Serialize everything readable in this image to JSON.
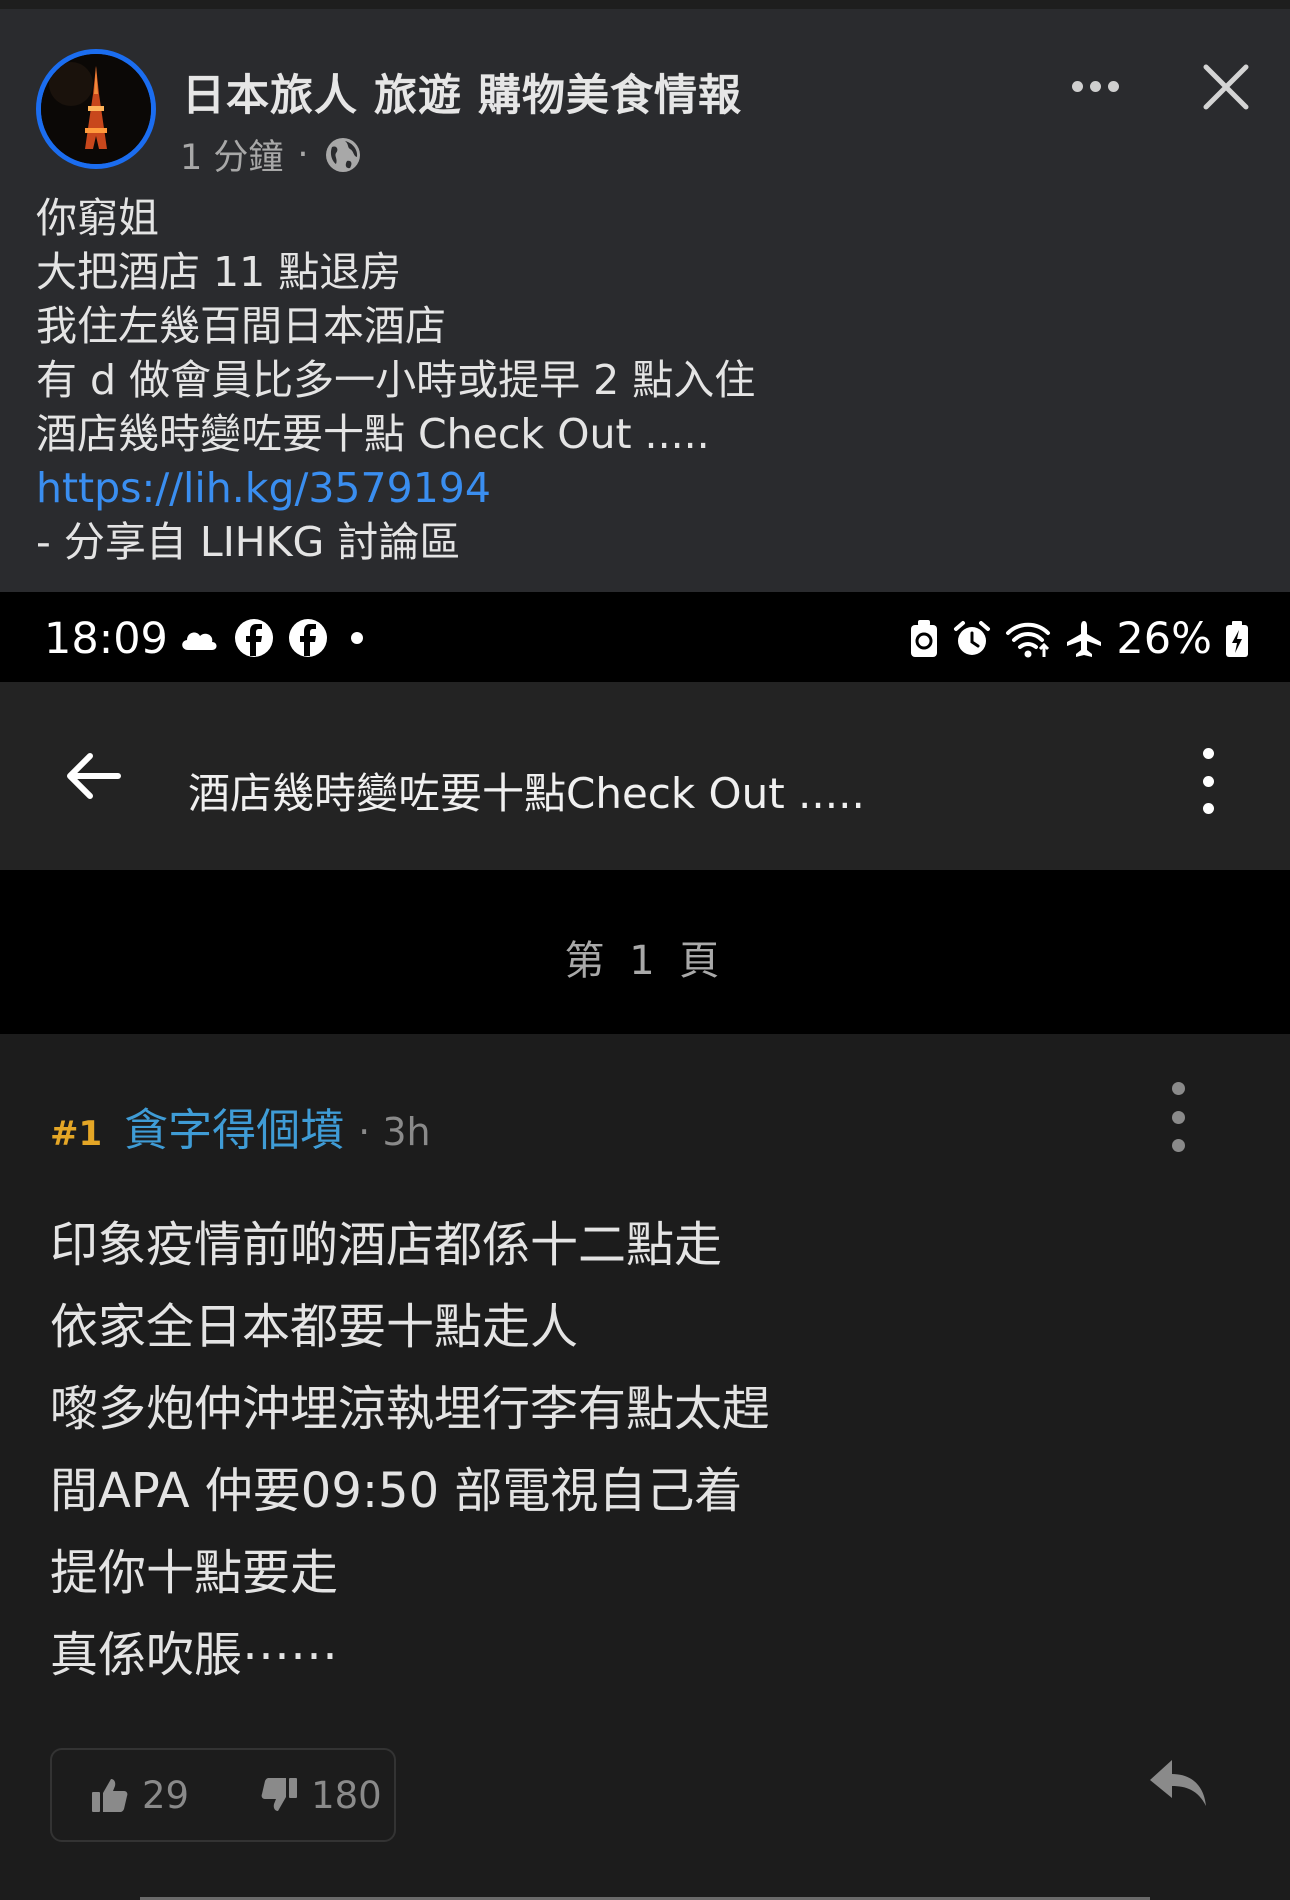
{
  "post": {
    "page_name": "日本旅人  旅遊 購物美食情報",
    "time": "1 分鐘",
    "separator": "·",
    "lines": [
      "你窮姐",
      "大把酒店 11 點退房",
      "我住左幾百間日本酒店",
      "有 d 做會員比多一小時或提早 2 點入住",
      "酒店幾時變咗要十點 Check Out ....."
    ],
    "link": "https://lih.kg/3579194",
    "source": "- 分享自 LIHKG 討論區"
  },
  "status_bar": {
    "time": "18:09",
    "battery": "26%",
    "left_icons": [
      "cloud-icon",
      "facebook-icon",
      "facebook-icon",
      "dot-icon"
    ],
    "right_icons": [
      "battery-saver-icon",
      "alarm-icon",
      "wifi-icon",
      "airplane-icon",
      "battery-charging-icon"
    ]
  },
  "thread": {
    "title": "酒店幾時變咗要十點Check Out .....",
    "page_label": "第 1 頁"
  },
  "reply": {
    "floor": "#1",
    "username": "貪字得個墳",
    "time_ago": "· 3h",
    "lines": [
      "印象疫情前啲酒店都係十二點走",
      "依家全日本都要十點走人",
      "嚟多炮仲沖埋涼執埋行李有點太趕",
      "間APA 仲要09:50 部電視自己着",
      "提你十點要走",
      "真係吹脹⋯⋯"
    ],
    "likes": "29",
    "dislikes": "180"
  },
  "colors": {
    "fb_background": "#2a2b2e",
    "link": "#3a8ef0",
    "avatar_ring": "#1b6df0",
    "floor_number": "#e4a626",
    "username": "#3f9cd6"
  }
}
